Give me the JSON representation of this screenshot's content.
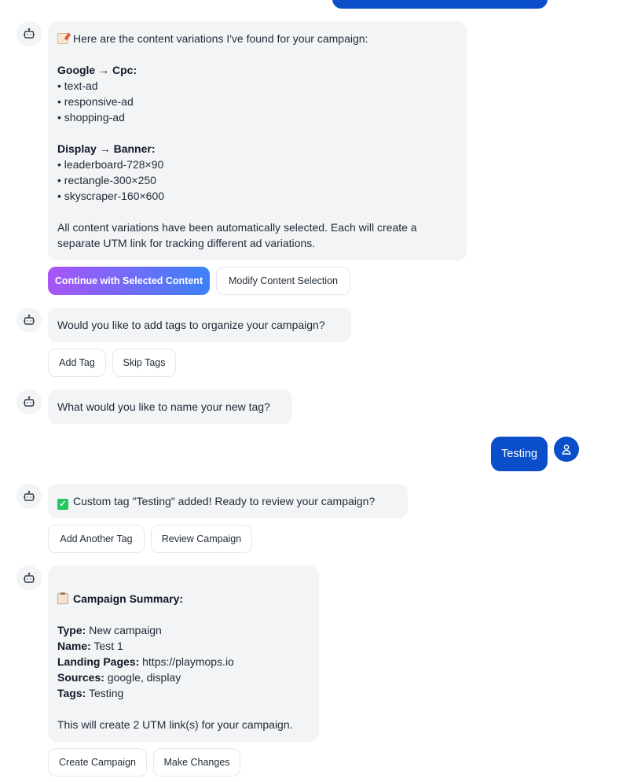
{
  "messages": {
    "content_variations": {
      "intro": "Here are the content variations I've found for your campaign:",
      "google_heading": "Google → Cpc:",
      "google_items": [
        "• text-ad",
        "• responsive-ad",
        "• shopping-ad"
      ],
      "display_heading": "Display → Banner:",
      "display_items": [
        "• leaderboard-728×90",
        "• rectangle-300×250",
        "• skyscraper-160×600"
      ],
      "outro_line1": "All content variations have been automatically selected. Each will create a",
      "outro_line2": "separate UTM link for tracking different ad variations."
    },
    "tags_question": "Would you like to add tags to organize your campaign?",
    "tag_name_question": "What would you like to name your new tag?",
    "user_reply": "Testing",
    "tag_added": "Custom tag \"Testing\" added! Ready to review your campaign?",
    "summary": {
      "heading": "Campaign Summary:",
      "type_label": "Type:",
      "type_value": " New campaign",
      "name_label": "Name:",
      "name_value": " Test 1",
      "landing_label": "Landing Pages:",
      "landing_value": " https://playmops.io",
      "sources_label": "Sources:",
      "sources_value": " google, display",
      "tags_label": "Tags:",
      "tags_value": " Testing",
      "footer": "This will create 2 UTM link(s) for your campaign."
    }
  },
  "buttons": {
    "continue_selected": "Continue with Selected Content",
    "modify_content": "Modify Content Selection",
    "add_tag": "Add Tag",
    "skip_tags": "Skip Tags",
    "add_another_tag": "Add Another Tag",
    "review_campaign": "Review Campaign",
    "create_campaign": "Create Campaign",
    "make_changes": "Make Changes"
  },
  "icons": {
    "bot": "bot-icon",
    "user": "user-icon",
    "memo": "memo-icon",
    "check": "check-mark-icon",
    "clipboard": "clipboard-icon"
  },
  "colors": {
    "user_bubble": "#0a4fc9",
    "bot_bubble": "#f3f4f6",
    "primary_gradient_start": "#a855f7",
    "primary_gradient_end": "#3b82f6"
  }
}
